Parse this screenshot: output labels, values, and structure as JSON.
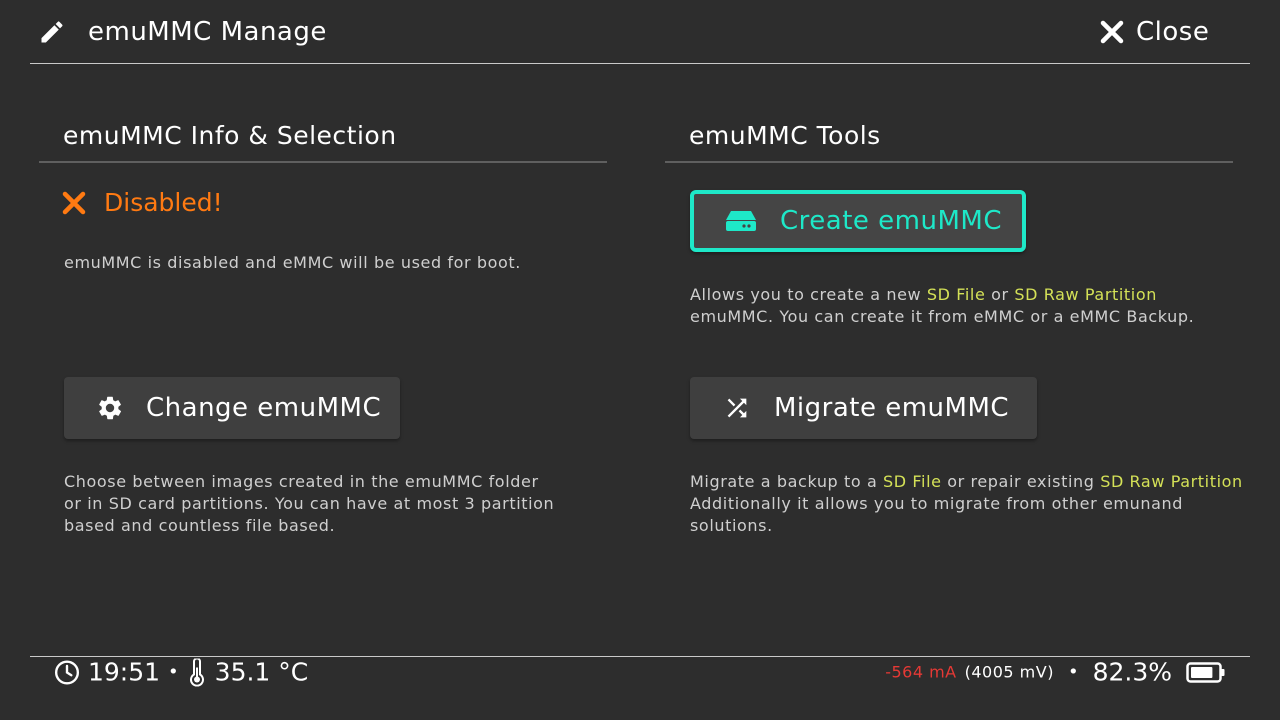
{
  "header": {
    "title": "emuMMC Manage",
    "title_icon": "pencil-icon",
    "close_label": "Close",
    "close_icon": "x-icon"
  },
  "left": {
    "section_title": "emuMMC Info & Selection",
    "status": {
      "icon": "x-icon",
      "text": "Disabled!",
      "color": "#ff7a12"
    },
    "status_desc": "emuMMC is disabled and eMMC will be used for boot.",
    "change_button": {
      "icon": "gear-icon",
      "label": "Change emuMMC"
    },
    "change_desc_lines": [
      "Choose between images created in the emuMMC folder",
      "or in SD card partitions. You can have at most 3 partition",
      "based and countless file based."
    ]
  },
  "right": {
    "section_title": "emuMMC Tools",
    "create_button": {
      "icon": "drive-icon",
      "label": "Create emuMMC",
      "accent": "#1ee8c8"
    },
    "create_desc": {
      "line1_a": "Allows you to create a new ",
      "line1_hl1": "SD File",
      "line1_b": " or ",
      "line1_hl2": "SD Raw Partition",
      "line2": "emuMMC. You can create it from eMMC or a eMMC Backup."
    },
    "migrate_button": {
      "icon": "shuffle-icon",
      "label": "Migrate emuMMC"
    },
    "migrate_desc": {
      "line1_a": "Migrate a backup to a ",
      "line1_hl1": "SD File",
      "line1_b": " or repair existing ",
      "line1_hl2": "SD Raw Partition",
      "line2": "Additionally it allows you to migrate from other emunand",
      "line3": "solutions."
    },
    "highlight_color": "#d4e157"
  },
  "footer": {
    "clock_icon": "clock-icon",
    "time": "19:51",
    "separator": "•",
    "thermometer_icon": "thermometer-icon",
    "temperature": "35.1 °C",
    "current": "-564 mA",
    "current_color": "#e53935",
    "voltage": "(4005 mV)",
    "battery_percent": "82.3%",
    "battery_level": 0.823,
    "battery_icon": "battery-icon"
  }
}
